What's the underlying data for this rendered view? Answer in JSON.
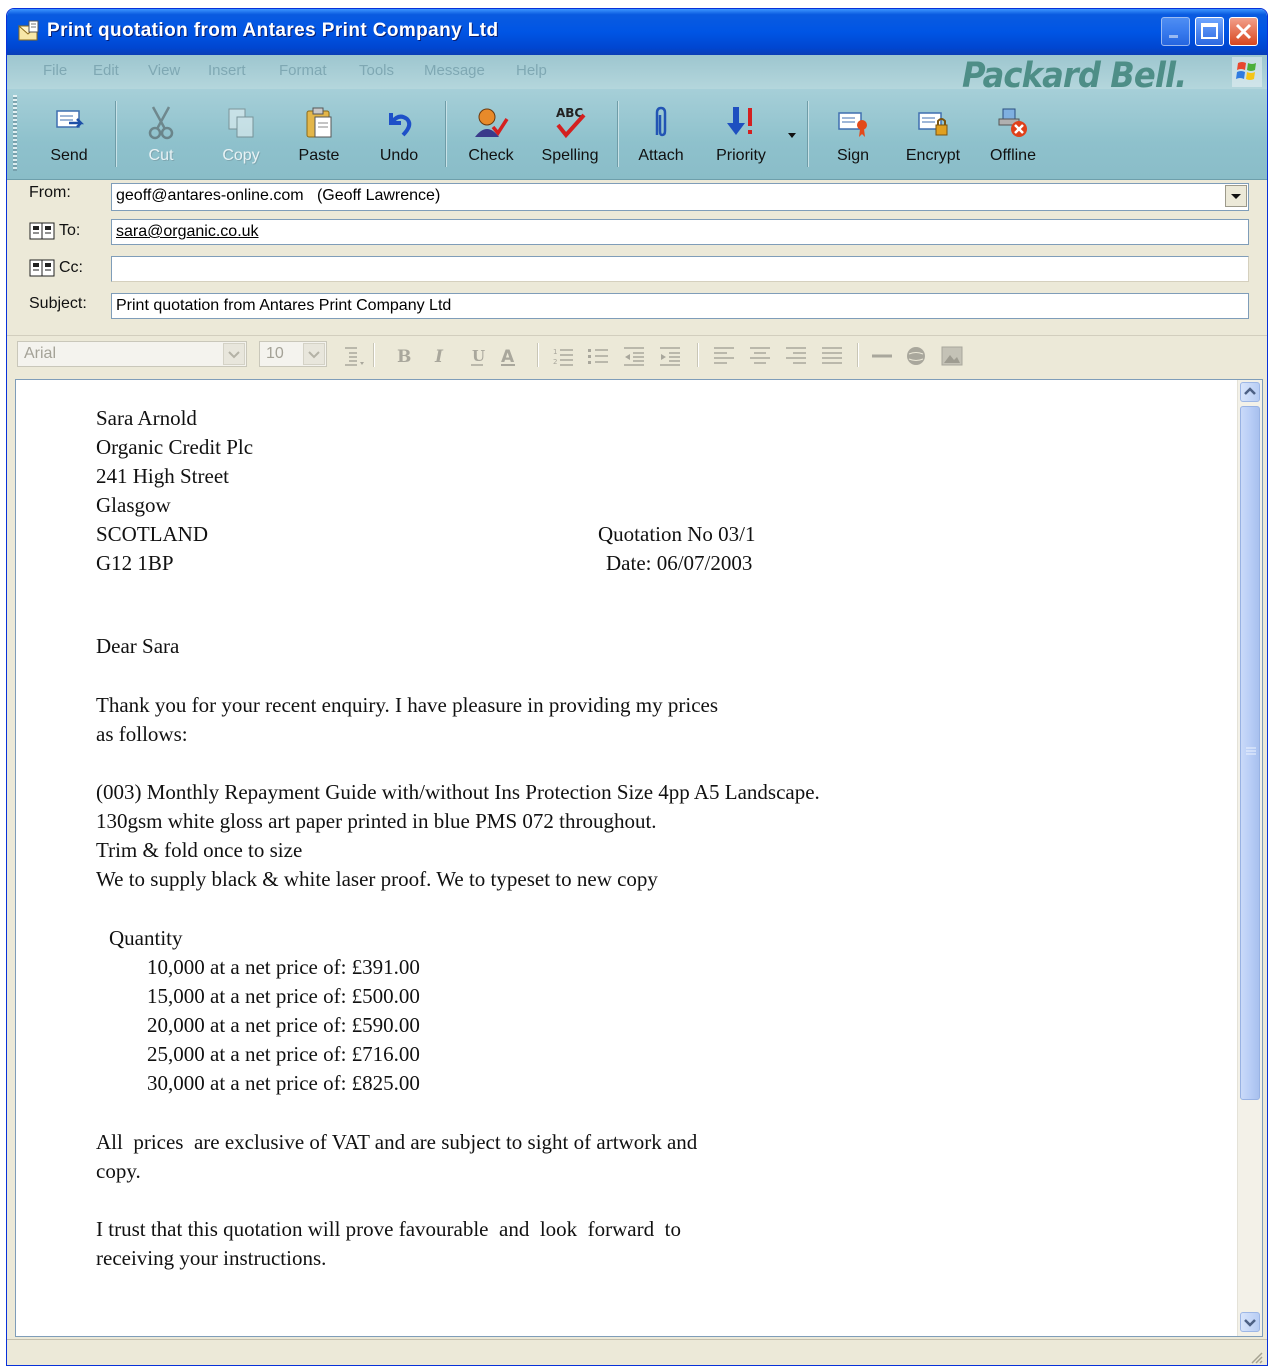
{
  "window": {
    "title": "Print quotation from Antares Print Company Ltd"
  },
  "menu": {
    "items": [
      "File",
      "Edit",
      "View",
      "Insert",
      "Format",
      "Tools",
      "Message",
      "Help"
    ],
    "brand": "Packard Bell."
  },
  "toolbar": {
    "send": "Send",
    "cut": "Cut",
    "copy": "Copy",
    "paste": "Paste",
    "undo": "Undo",
    "check": "Check",
    "spelling": "Spelling",
    "attach": "Attach",
    "priority": "Priority",
    "sign": "Sign",
    "encrypt": "Encrypt",
    "offline": "Offline"
  },
  "header": {
    "from_label": "From:",
    "from_value": "geoff@antares-online.com   (Geoff Lawrence)",
    "to_label": "To:",
    "to_value": "sara@organic.co.uk",
    "cc_label": "Cc:",
    "cc_value": "",
    "subject_label": "Subject:",
    "subject_value": "Print quotation from Antares Print Company Ltd"
  },
  "format_bar": {
    "font": "Arial",
    "size": "10"
  },
  "body": {
    "address": [
      "Sara Arnold",
      "Organic Credit Plc",
      "241 High Street",
      "Glasgow",
      "SCOTLAND",
      "G12 1BP"
    ],
    "quotation_no": "Quotation No 03/1",
    "date": "Date: 06/07/2003",
    "greeting": "Dear Sara",
    "intro": [
      "Thank you for your recent enquiry. I have pleasure in providing my prices",
      "as follows:"
    ],
    "spec": [
      "(003) Monthly Repayment Guide with/without Ins Protection Size 4pp A5 Landscape.",
      "130gsm white gloss art paper printed in blue PMS 072 throughout.",
      "Trim & fold once to size",
      "We to supply black & white laser proof. We to typeset to new copy"
    ],
    "quantity_heading": "Quantity",
    "prices": [
      "10,000 at a net price of: £391.00",
      "15,000 at a net price of: £500.00",
      "20,000 at a net price of: £590.00",
      "25,000 at a net price of: £716.00",
      "30,000 at a net price of: £825.00"
    ],
    "vat_note": [
      "All  prices  are exclusive of VAT and are subject to sight of artwork and",
      "copy."
    ],
    "closing": [
      "I trust that this quotation will prove favourable  and  look  forward  to",
      "receiving your instructions."
    ]
  },
  "colors": {
    "titlebar": "#0055E5",
    "toolbar_bg": "#8EC1CC",
    "window_bg": "#ECE9D8"
  }
}
